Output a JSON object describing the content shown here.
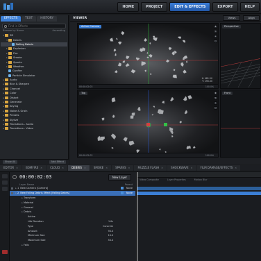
{
  "topnav": [
    "HOME",
    "PROJECT",
    "EDIT & EFFECTS",
    "EXPORT",
    "HELP"
  ],
  "topnav_active": "EDIT & EFFECTS",
  "left": {
    "tabs": [
      "EFFECTS",
      "TEXT",
      "HISTORY"
    ],
    "search_placeholder": "Find in Effects",
    "sort_left": "Browse by Name",
    "sort_right": "Ascending",
    "tree": [
      {
        "label": "3D",
        "level": 0,
        "open": true,
        "kind": "folder"
      },
      {
        "label": "Debris",
        "level": 1,
        "open": true,
        "kind": "folder"
      },
      {
        "label": "Falling Debris",
        "level": 2,
        "kind": "fx",
        "selected": true
      },
      {
        "label": "Explosion",
        "level": 1,
        "kind": "folder"
      },
      {
        "label": "Fire",
        "level": 1,
        "kind": "folder"
      },
      {
        "label": "Smoke",
        "level": 1,
        "kind": "folder"
      },
      {
        "label": "Sparks",
        "level": 1,
        "kind": "folder"
      },
      {
        "label": "Weather",
        "level": 1,
        "kind": "folder"
      },
      {
        "label": "Gunfire",
        "level": 1,
        "kind": "fx"
      },
      {
        "label": "Particle Simulator",
        "level": 1,
        "kind": "fx"
      },
      {
        "label": "Audio",
        "level": 0,
        "kind": "folder"
      },
      {
        "label": "Blur & Sharpen",
        "level": 0,
        "kind": "folder"
      },
      {
        "label": "Channel",
        "level": 0,
        "kind": "folder"
      },
      {
        "label": "Color",
        "level": 0,
        "kind": "folder"
      },
      {
        "label": "Distort",
        "level": 0,
        "kind": "folder"
      },
      {
        "label": "Generate",
        "level": 0,
        "kind": "folder"
      },
      {
        "label": "Keying",
        "level": 0,
        "kind": "folder"
      },
      {
        "label": "Noise & Grain",
        "level": 0,
        "kind": "folder"
      },
      {
        "label": "Presets",
        "level": 0,
        "kind": "folder"
      },
      {
        "label": "Stylize",
        "level": 0,
        "kind": "folder"
      },
      {
        "label": "Transitions - Audio",
        "level": 0,
        "kind": "folder"
      },
      {
        "label": "Transitions - Video",
        "level": 0,
        "kind": "folder"
      }
    ],
    "footer_left": "Show All",
    "footer_right": "Add Effect"
  },
  "viewer": {
    "title": "VIEWER",
    "views_label": "Views",
    "align_label": "Align",
    "vp_main_label": "Active Camera",
    "vp_persp_label": "Perspective",
    "vp_top_label": "Top",
    "vp_front_label": "Front",
    "timecode_small": "00:00:02:03",
    "zoom": "100.0%",
    "coords": [
      "X: 481.50",
      "Y: 195.00"
    ]
  },
  "bottom_tabs": [
    "EDITOR",
    "BOMFIRE",
    "CLOUD",
    "DEBRIS",
    "SMOKE",
    "SPARKS",
    "MUZZLE FLASH",
    "SHOCKWAVE",
    "FILM DAMAGE/EFFECTS"
  ],
  "bottom_tabs_active": "DEBRIS",
  "timeline": {
    "timecode": "00:00:02:03",
    "new_layer": "New Layer",
    "col_header": "Layer Name",
    "col_parent": "Parent",
    "track_labels": [
      "Video Composite",
      "Layer Properties",
      "Motion Blur"
    ],
    "layers": [
      {
        "num": "1",
        "label": "New Camera [Camera]",
        "parent": "None",
        "color": "#4a90d9"
      },
      {
        "num": "2",
        "label": "New Falling Debris Effect [Falling Debris]",
        "parent": "None",
        "color": "#4a90d9",
        "selected": true
      }
    ],
    "props": [
      {
        "label": "Transform",
        "indent": 1
      },
      {
        "label": "Material",
        "indent": 1
      },
      {
        "label": "General",
        "indent": 1
      },
      {
        "label": "Debris",
        "indent": 1
      },
      {
        "label": "Active",
        "indent": 2,
        "value": ""
      },
      {
        "label": "Life Duration",
        "indent": 2,
        "value": "1.0s"
      },
      {
        "label": "Type",
        "indent": 2,
        "value": "Concrete"
      },
      {
        "label": "Amount",
        "indent": 2,
        "value": "90.0"
      },
      {
        "label": "Minimum Size",
        "indent": 2,
        "value": "10.0"
      },
      {
        "label": "Maximum Size",
        "indent": 2,
        "value": "50.0"
      },
      {
        "label": "Falls",
        "indent": 1,
        "value": ""
      }
    ]
  }
}
